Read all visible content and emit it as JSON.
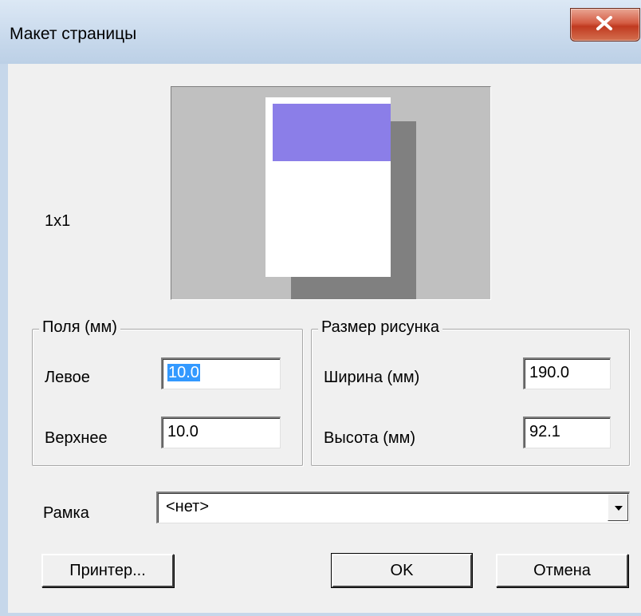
{
  "window": {
    "title": "Макет страницы",
    "close_icon": "close-icon"
  },
  "preview": {
    "layout_label": "1x1",
    "colors": {
      "background": "#c0c0c0",
      "paper": "#ffffff",
      "shadow": "#808080",
      "image": "#8b7ee8"
    }
  },
  "margins": {
    "legend": "Поля (мм)",
    "left_label": "Левое",
    "left_value": "10.0",
    "top_label": "Верхнее",
    "top_value": "10.0"
  },
  "size": {
    "legend": "Размер рисунка",
    "width_label": "Ширина (мм)",
    "width_value": "190.0",
    "height_label": "Высота (мм)",
    "height_value": "92.1"
  },
  "frame": {
    "label": "Рамка",
    "selected": "<нет>",
    "arrow_icon": "chevron-down-icon"
  },
  "buttons": {
    "printer": "Принтер...",
    "ok": "OK",
    "cancel": "Отмена"
  }
}
